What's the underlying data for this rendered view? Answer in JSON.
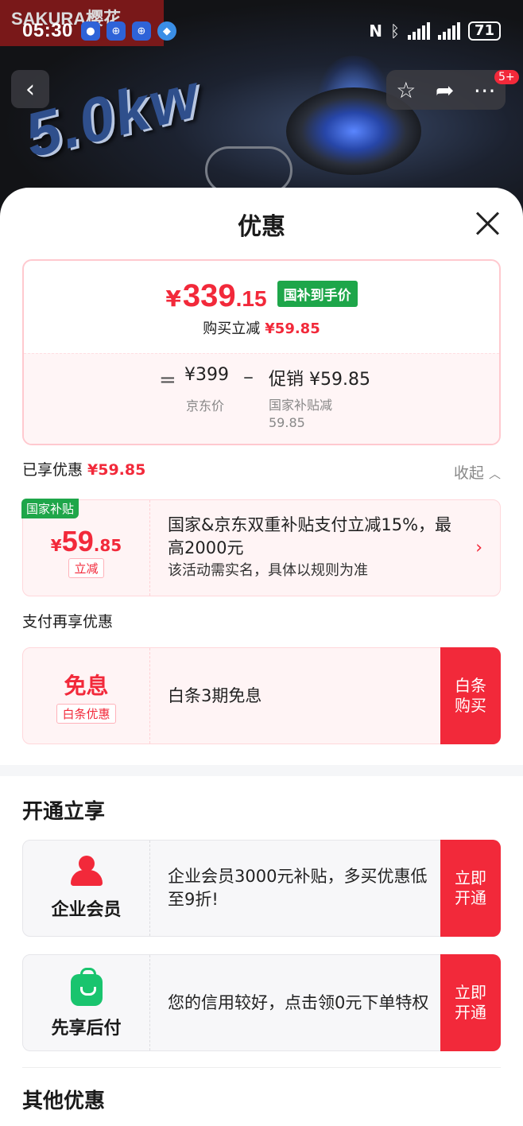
{
  "status_bar": {
    "time": "05:30",
    "battery": "71"
  },
  "hero": {
    "brand": "SAKURA樱花",
    "power_label": "5.0kw"
  },
  "nav": {
    "back": "‹",
    "badge": "5+"
  },
  "sheet": {
    "title": "优惠",
    "price": {
      "currency": "¥",
      "integer": "339",
      "decimal": ".15",
      "tag": "国补到手价",
      "reduce_label": "购买立减",
      "reduce_value": "¥59.85",
      "equals": "=",
      "jd_price": "¥399",
      "jd_label": "京东价",
      "minus": "–",
      "promo_value": "促销 ¥59.85",
      "promo_label": "国家补贴减59.85"
    },
    "enjoyed": {
      "label": "已享优惠",
      "value": "¥59.85",
      "collapse": "收起"
    },
    "subsidy": {
      "flag": "国家补贴",
      "currency": "¥",
      "integer": "59",
      "decimal": ".85",
      "pill": "立减",
      "title": "国家&京东双重补贴支付立减15%，最高2000元",
      "subtitle": "该活动需实名，具体以规则为准"
    },
    "pay_section": "支付再享优惠",
    "baitiao": {
      "big": "免息",
      "pill": "白条优惠",
      "desc": "白条3期免息",
      "button": "白条\n购买"
    },
    "open_section": "开通立享",
    "enterprise": {
      "name": "企业会员",
      "desc": "企业会员3000元补贴，多买优惠低至9折!",
      "button": "立即\n开通"
    },
    "paylater": {
      "name": "先享后付",
      "desc": "您的信用较好，点击领0元下单特权",
      "button": "立即\n开通"
    },
    "other_section": "其他优惠"
  },
  "colors": {
    "accent": "#f2293a",
    "green_tag": "#1ea64a"
  }
}
